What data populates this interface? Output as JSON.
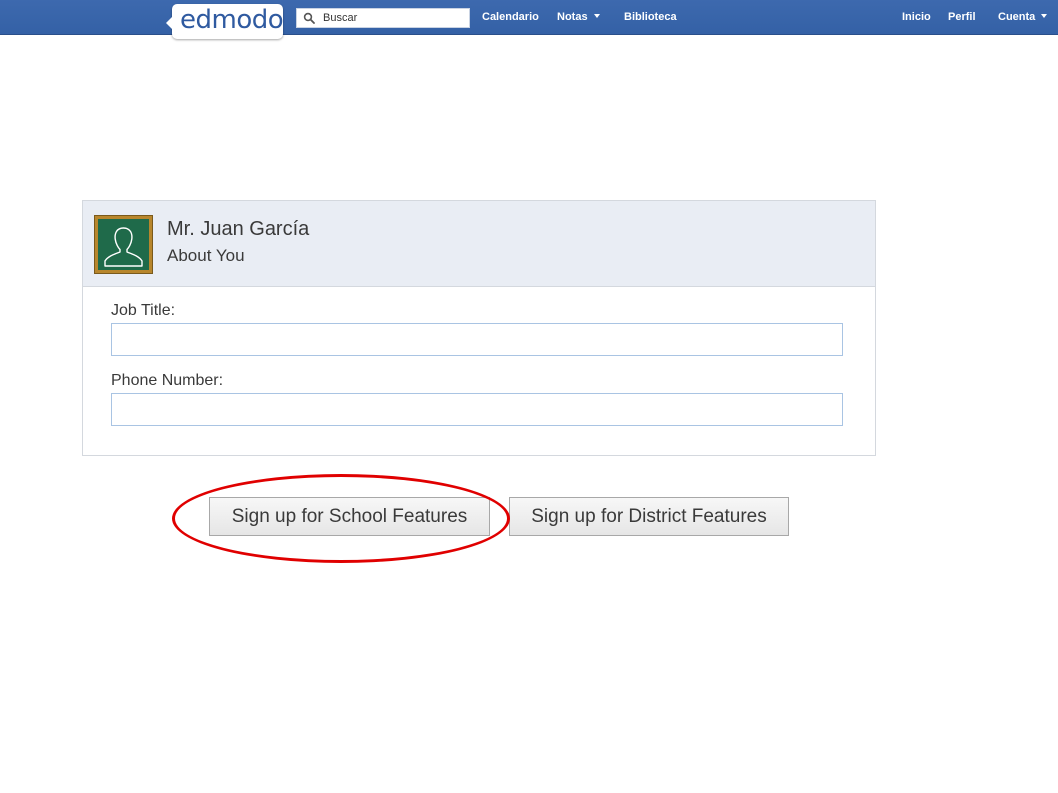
{
  "topbar": {
    "logo_text": "edmodo",
    "search_placeholder": "Buscar",
    "nav": {
      "calendar": "Calendario",
      "grades": "Notas",
      "library": "Biblioteca",
      "home": "Inicio",
      "profile": "Perfil",
      "account": "Cuenta"
    },
    "colors": {
      "bar": "#3d69ae",
      "logo_text": "#2f5aa0"
    }
  },
  "card": {
    "name": "Mr. Juan García",
    "subtitle": "About You",
    "avatar_icon": "person-silhouette-icon",
    "fields": [
      {
        "label": "Job Title:",
        "value": ""
      },
      {
        "label": "Phone Number:",
        "value": ""
      }
    ]
  },
  "buttons": {
    "school": "Sign up for School Features",
    "district": "Sign up for District Features"
  },
  "annotation": {
    "highlight_color": "#e00000"
  }
}
